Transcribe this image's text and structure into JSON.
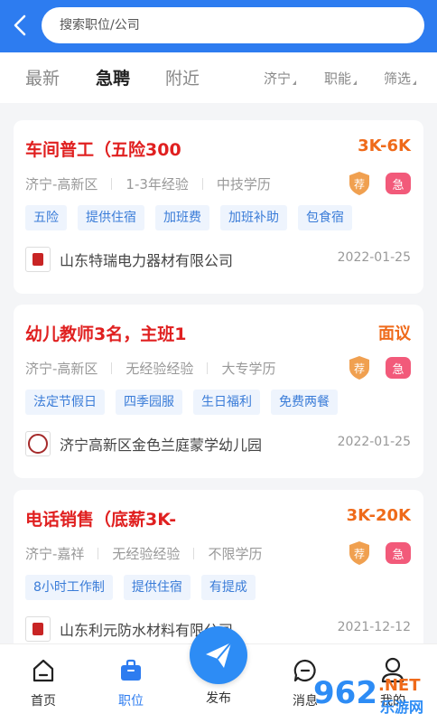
{
  "header": {
    "search_placeholder": "搜索职位/公司",
    "bg_color": "#2d7cf0"
  },
  "tabs": [
    {
      "label": "最新",
      "active": false
    },
    {
      "label": "急聘",
      "active": true
    },
    {
      "label": "附近",
      "active": false
    }
  ],
  "filters": [
    {
      "label": "济宁"
    },
    {
      "label": "职能"
    },
    {
      "label": "筛选"
    }
  ],
  "jobs": [
    {
      "title": "车间普工（五险300",
      "salary": "3K-6K",
      "location": "济宁-高新区",
      "experience": "1-3年经验",
      "education": "中技学历",
      "badge_recommend": "荐",
      "badge_urgent": "急",
      "tags": [
        "五险",
        "提供住宿",
        "加班费",
        "加班补助",
        "包食宿"
      ],
      "company": "山东特瑞电力器材有限公司",
      "date": "2022-01-25"
    },
    {
      "title": "幼儿教师3名，主班1",
      "salary": "面议",
      "location": "济宁-高新区",
      "experience": "无经验经验",
      "education": "大专学历",
      "badge_recommend": "荐",
      "badge_urgent": "急",
      "tags": [
        "法定节假日",
        "四季园服",
        "生日福利",
        "免费两餐"
      ],
      "company": "济宁高新区金色兰庭蒙学幼儿园",
      "date": "2022-01-25"
    },
    {
      "title": "电话销售（底薪3K-",
      "salary": "3K-20K",
      "location": "济宁-嘉祥",
      "experience": "无经验经验",
      "education": "不限学历",
      "badge_recommend": "荐",
      "badge_urgent": "急",
      "tags": [
        "8小时工作制",
        "提供住宿",
        "有提成"
      ],
      "company": "山东利元防水材料有限公司",
      "date": "2021-12-12"
    }
  ],
  "bottom_nav": {
    "home": "首页",
    "jobs": "职位",
    "publish": "发布",
    "messages": "消息",
    "profile": "我的"
  },
  "colors": {
    "title": "#e02020",
    "salary": "#ef6a1a",
    "tag_text": "#3a7cd8",
    "tag_bg": "#eef4fd",
    "urgent": "#f25a7a",
    "recommend": "#f0a050"
  },
  "watermark": {
    "brand": "962",
    "suffix": ".NET",
    "sub": "乐游网"
  }
}
